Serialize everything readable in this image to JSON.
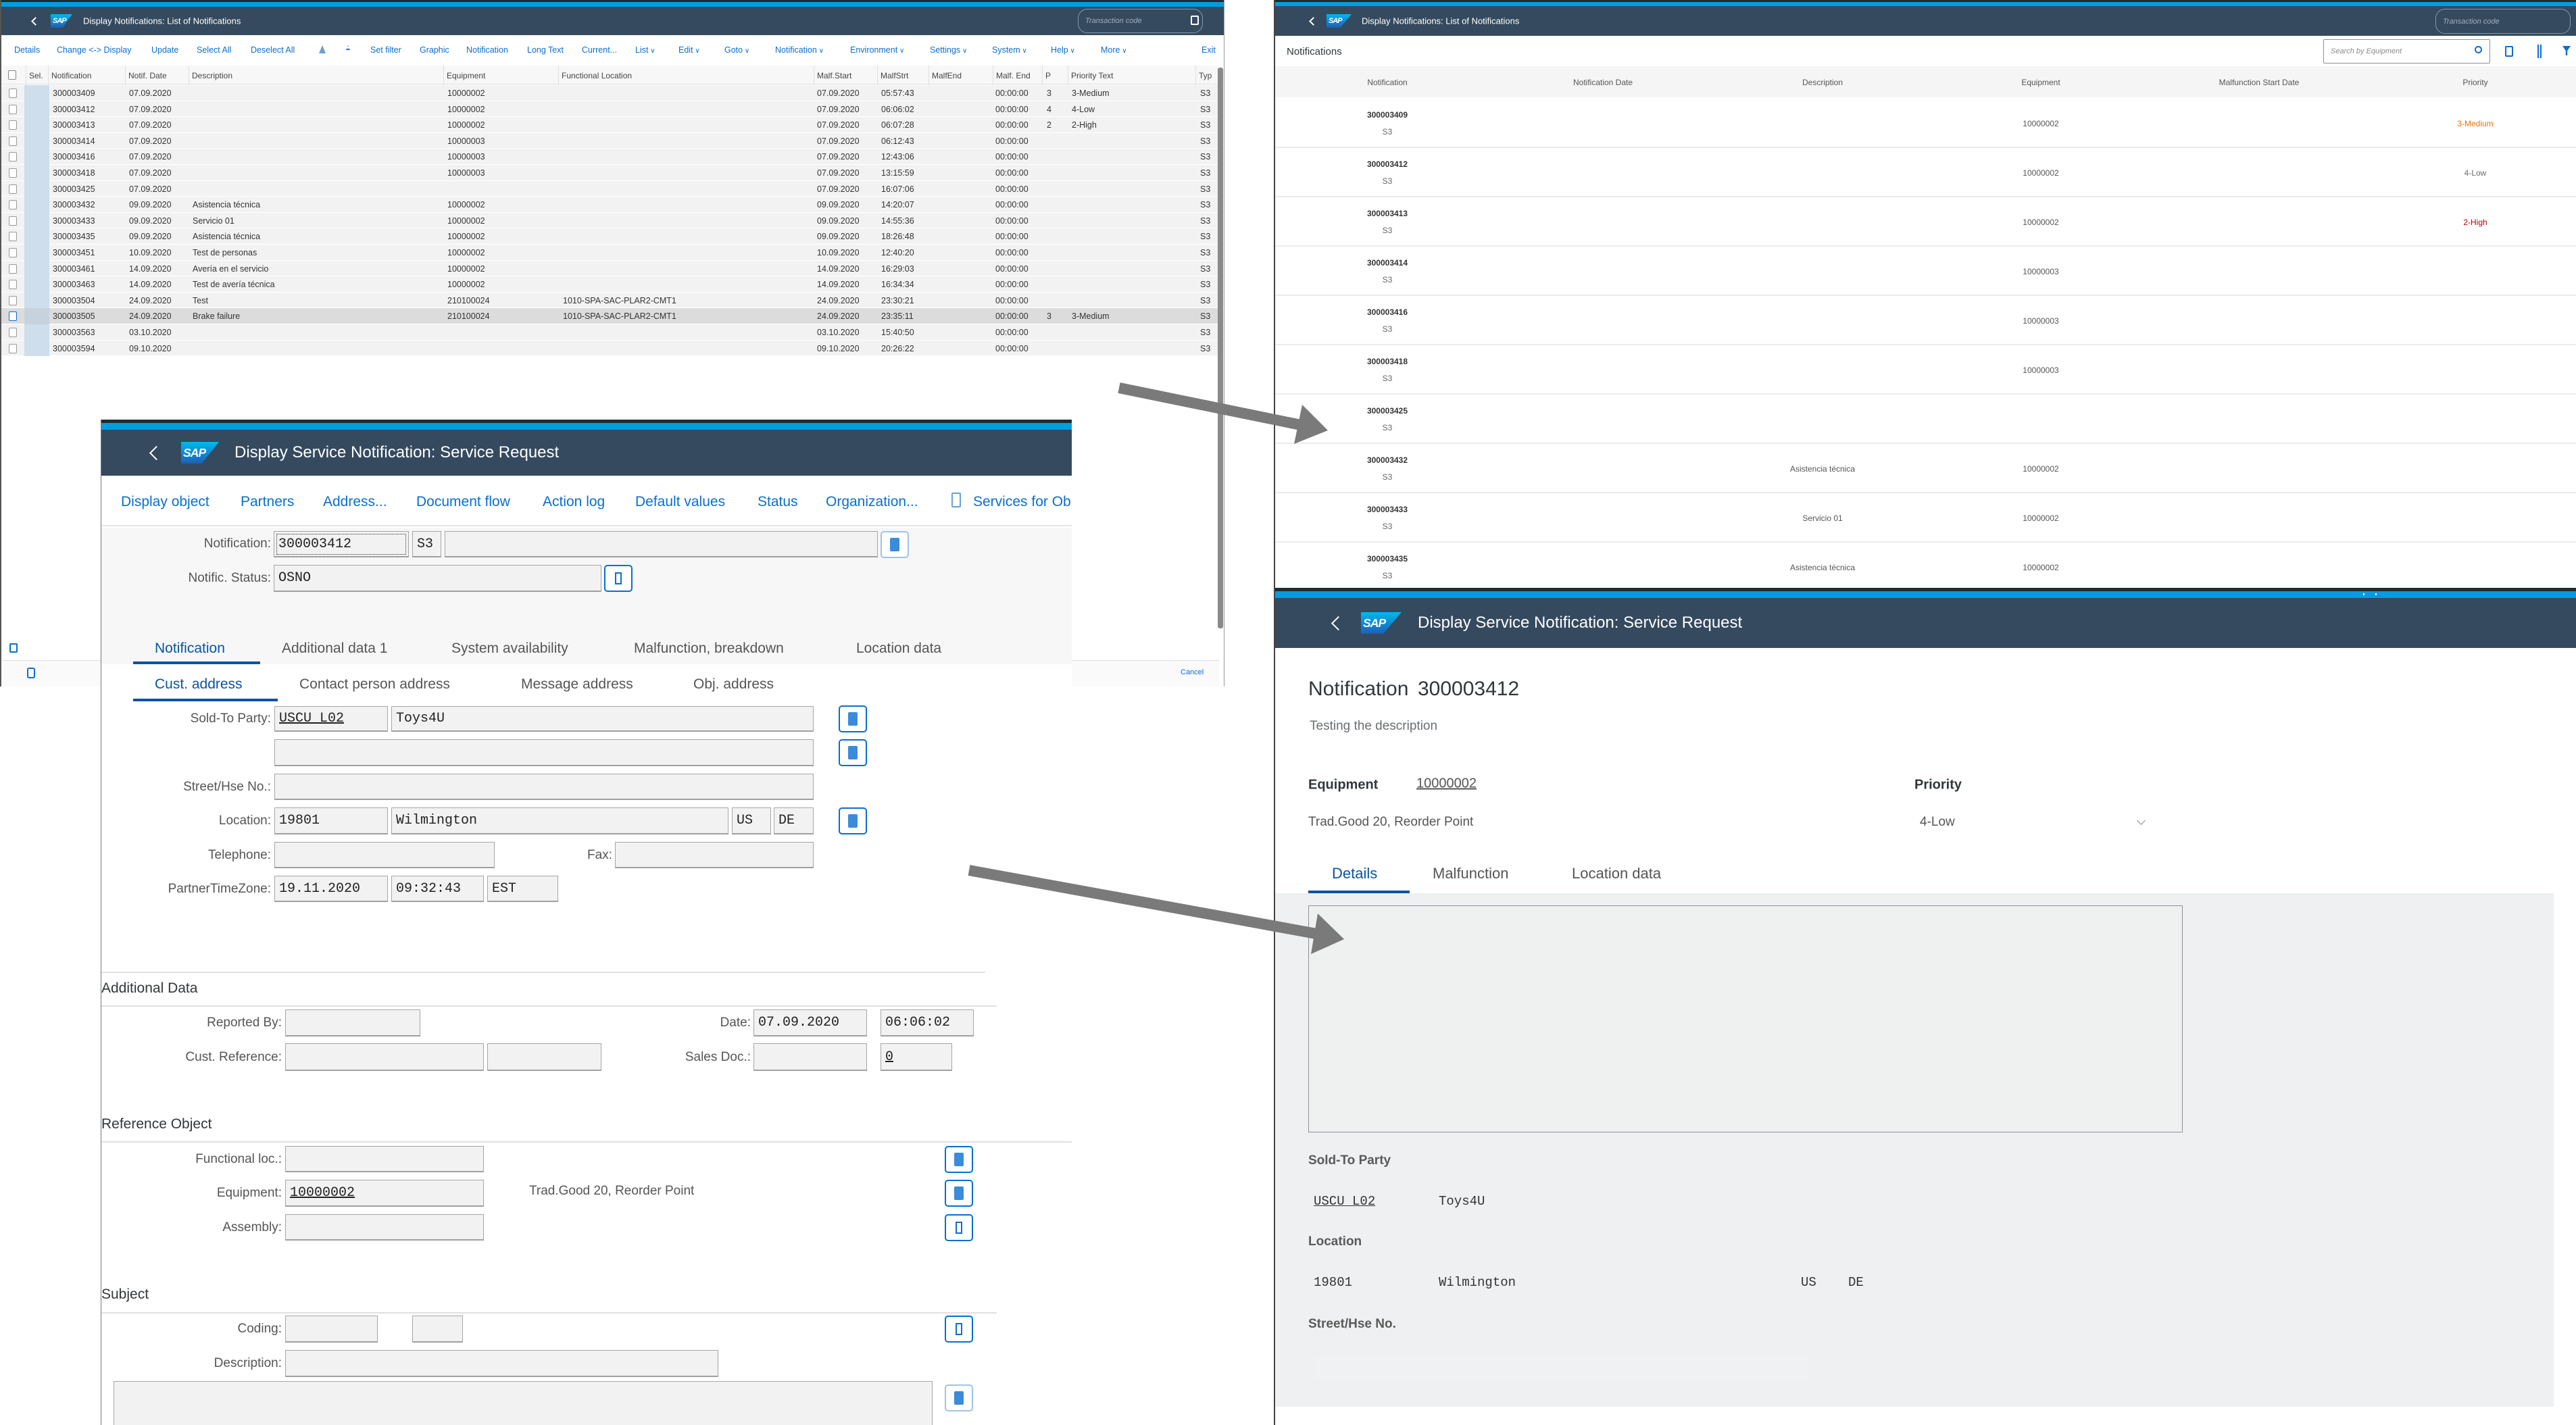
{
  "colors": {
    "shell": "#354a5f",
    "accent_stripe": "#009de0",
    "link": "#0a6ed1",
    "tab_active": "#0854a0",
    "priority_medium": "#e9730c",
    "priority_high": "#bb0000",
    "annotation_arrow": "#7a7a7a"
  },
  "logo_text": "SAP",
  "list_window": {
    "title": "Display Notifications: List of Notifications",
    "transaction_placeholder": "Transaction code",
    "toolbar": [
      {
        "label": "Details"
      },
      {
        "label": "Change <-> Display"
      },
      {
        "label": "Update"
      },
      {
        "label": "Select All"
      },
      {
        "label": "Deselect All"
      },
      {
        "icon": "sort-ascending-icon"
      },
      {
        "icon": "filter-icon"
      },
      {
        "label": "Set filter"
      },
      {
        "label": "Graphic"
      },
      {
        "label": "Notification"
      },
      {
        "label": "Long Text"
      },
      {
        "label": "Current..."
      },
      {
        "label": "List",
        "dropdown": true
      },
      {
        "label": "Edit",
        "dropdown": true
      },
      {
        "label": "Goto",
        "dropdown": true
      },
      {
        "label": "Notification",
        "dropdown": true
      },
      {
        "label": "Environment",
        "dropdown": true
      },
      {
        "label": "Settings",
        "dropdown": true
      },
      {
        "label": "System",
        "dropdown": true
      },
      {
        "label": "Help",
        "dropdown": true
      },
      {
        "label": "More",
        "dropdown": true
      }
    ],
    "exit_label": "Exit",
    "columns": [
      "Sel.",
      "Notification",
      "Notif. Date",
      "Description",
      "Equipment",
      "Functional Location",
      "Malf.Start",
      "MalfStrt",
      "MalfEnd",
      "Malf. End",
      "P",
      "Priority Text",
      "Typ"
    ],
    "rows": [
      [
        "300003409",
        "07.09.2020",
        "",
        "10000002",
        "",
        "07.09.2020",
        "05:57:43",
        "",
        "00:00:00",
        "3",
        "3-Medium",
        "S3"
      ],
      [
        "300003412",
        "07.09.2020",
        "",
        "10000002",
        "",
        "07.09.2020",
        "06:06:02",
        "",
        "00:00:00",
        "4",
        "4-Low",
        "S3"
      ],
      [
        "300003413",
        "07.09.2020",
        "",
        "10000002",
        "",
        "07.09.2020",
        "06:07:28",
        "",
        "00:00:00",
        "2",
        "2-High",
        "S3"
      ],
      [
        "300003414",
        "07.09.2020",
        "",
        "10000003",
        "",
        "07.09.2020",
        "06:12:43",
        "",
        "00:00:00",
        "",
        "",
        "S3"
      ],
      [
        "300003416",
        "07.09.2020",
        "",
        "10000003",
        "",
        "07.09.2020",
        "12:43:06",
        "",
        "00:00:00",
        "",
        "",
        "S3"
      ],
      [
        "300003418",
        "07.09.2020",
        "",
        "10000003",
        "",
        "07.09.2020",
        "13:15:59",
        "",
        "00:00:00",
        "",
        "",
        "S3"
      ],
      [
        "300003425",
        "07.09.2020",
        "",
        "",
        "",
        "07.09.2020",
        "16:07:06",
        "",
        "00:00:00",
        "",
        "",
        "S3"
      ],
      [
        "300003432",
        "09.09.2020",
        "Asistencia técnica",
        "10000002",
        "",
        "09.09.2020",
        "14:20:07",
        "",
        "00:00:00",
        "",
        "",
        "S3"
      ],
      [
        "300003433",
        "09.09.2020",
        "Servicio 01",
        "10000002",
        "",
        "09.09.2020",
        "14:55:36",
        "",
        "00:00:00",
        "",
        "",
        "S3"
      ],
      [
        "300003435",
        "09.09.2020",
        "Asistencia técnica",
        "10000002",
        "",
        "09.09.2020",
        "18:26:48",
        "",
        "00:00:00",
        "",
        "",
        "S3"
      ],
      [
        "300003451",
        "10.09.2020",
        "Test de personas",
        "10000002",
        "",
        "10.09.2020",
        "12:40:20",
        "",
        "00:00:00",
        "",
        "",
        "S3"
      ],
      [
        "300003461",
        "14.09.2020",
        "Avería en el servicio",
        "10000002",
        "",
        "14.09.2020",
        "16:29:03",
        "",
        "00:00:00",
        "",
        "",
        "S3"
      ],
      [
        "300003463",
        "14.09.2020",
        "Test de avería técnica",
        "10000002",
        "",
        "14.09.2020",
        "16:34:34",
        "",
        "00:00:00",
        "",
        "",
        "S3"
      ],
      [
        "300003504",
        "24.09.2020",
        "Test",
        "210100024",
        "1010-SPA-SAC-PLAR2-CMT1",
        "24.09.2020",
        "23:30:21",
        "",
        "00:00:00",
        "",
        "",
        "S3"
      ],
      [
        "300003505",
        "24.09.2020",
        "Brake failure",
        "210100024",
        "1010-SPA-SAC-PLAR2-CMT1",
        "24.09.2020",
        "23:35:11",
        "",
        "00:00:00",
        "3",
        "3-Medium",
        "S3"
      ],
      [
        "300003563",
        "03.10.2020",
        "",
        "",
        "",
        "03.10.2020",
        "15:40:50",
        "",
        "00:00:00",
        "",
        "",
        "S3"
      ],
      [
        "300003594",
        "09.10.2020",
        "",
        "",
        "",
        "09.10.2020",
        "20:26:22",
        "",
        "00:00:00",
        "",
        "",
        "S3"
      ]
    ],
    "highlighted_row": "300003505",
    "cancel_label": "Cancel"
  },
  "dialog": {
    "title": "Display Service Notification: Service Request",
    "toolbar": [
      "Display object",
      "Partners",
      "Address...",
      "Document flow",
      "Action log",
      "Default values",
      "Status",
      "Organization...",
      "Services for Ob"
    ],
    "notification_label": "Notification:",
    "notification": "300003412",
    "type": "S3",
    "short_text": "",
    "status_label": "Notific. Status:",
    "status": "OSNO",
    "tabs": [
      "Notification",
      "Additional data 1",
      "System availability",
      "Malfunction, breakdown",
      "Location data"
    ],
    "subtabs": [
      "Cust. address",
      "Contact person address",
      "Message address",
      "Obj. address"
    ],
    "sold_to_label": "Sold-To Party:",
    "sold_to_id": "USCU_L02",
    "sold_to_name": "Toys4U",
    "street_label": "Street/Hse No.:",
    "location_label": "Location:",
    "postal": "19801",
    "city": "Wilmington",
    "country": "US",
    "region": "DE",
    "telephone_label": "Telephone:",
    "fax_label": "Fax:",
    "tz_label": "PartnerTimeZone:",
    "tz_date": "19.11.2020",
    "tz_time": "09:32:43",
    "tz": "EST",
    "additional_heading": "Additional Data",
    "reported_by_label": "Reported By:",
    "date_label": "Date:",
    "date": "07.09.2020",
    "time": "06:06:02",
    "cust_ref_label": "Cust. Reference:",
    "sales_doc_label": "Sales Doc.:",
    "sales_doc_item": "0",
    "reference_heading": "Reference Object",
    "funcloc_label": "Functional loc.:",
    "equipment_label": "Equipment:",
    "equipment": "10000002",
    "equipment_desc": "Trad.Good 20, Reorder Point",
    "assembly_label": "Assembly:",
    "subject_heading": "Subject",
    "coding_label": "Coding:",
    "description_label": "Description:"
  },
  "fiori_list": {
    "title": "Display Notifications: List of Notifications",
    "transaction_placeholder": "Transaction code",
    "section_title": "Notifications",
    "search_placeholder": "Search by Equipment",
    "columns": [
      "Notification",
      "Notification Date",
      "Description",
      "Equipment",
      "Malfunction Start Date",
      "Priority"
    ],
    "rows": [
      {
        "notification": "300003409",
        "type": "S3",
        "description": "",
        "equipment": "10000002",
        "priority": "3-Medium",
        "priority_color": "#e9730c"
      },
      {
        "notification": "300003412",
        "type": "S3",
        "description": "",
        "equipment": "10000002",
        "priority": "4-Low",
        "priority_color": "#6a6d70"
      },
      {
        "notification": "300003413",
        "type": "S3",
        "description": "",
        "equipment": "10000002",
        "priority": "2-High",
        "priority_color": "#bb0000"
      },
      {
        "notification": "300003414",
        "type": "S3",
        "description": "",
        "equipment": "10000003",
        "priority": ""
      },
      {
        "notification": "300003416",
        "type": "S3",
        "description": "",
        "equipment": "10000003",
        "priority": ""
      },
      {
        "notification": "300003418",
        "type": "S3",
        "description": "",
        "equipment": "10000003",
        "priority": ""
      },
      {
        "notification": "300003425",
        "type": "S3",
        "description": "",
        "equipment": "",
        "priority": ""
      },
      {
        "notification": "300003432",
        "type": "S3",
        "description": "Asistencia técnica",
        "equipment": "10000002",
        "priority": ""
      },
      {
        "notification": "300003433",
        "type": "S3",
        "description": "Servicio 01",
        "equipment": "10000002",
        "priority": ""
      },
      {
        "notification": "300003435",
        "type": "S3",
        "description": "Asistencia técnica",
        "equipment": "10000002",
        "priority": ""
      }
    ]
  },
  "fiori_detail": {
    "title": "Display Service Notification: Service Request",
    "heading_label": "Notification",
    "heading_value": "300003412",
    "description": "Testing the description",
    "equipment_label": "Equipment",
    "equipment": "10000002",
    "equipment_desc": "Trad.Good 20, Reorder Point",
    "priority_label": "Priority",
    "priority": "4-Low",
    "tabs": [
      "Details",
      "Malfunction",
      "Location data"
    ],
    "sold_to_label": "Sold-To Party",
    "sold_to_id": "USCU_L02",
    "sold_to_name": "Toys4U",
    "location_label": "Location",
    "postal": "19801",
    "city": "Wilmington",
    "country": "US",
    "region": "DE",
    "street_label": "Street/Hse No."
  }
}
